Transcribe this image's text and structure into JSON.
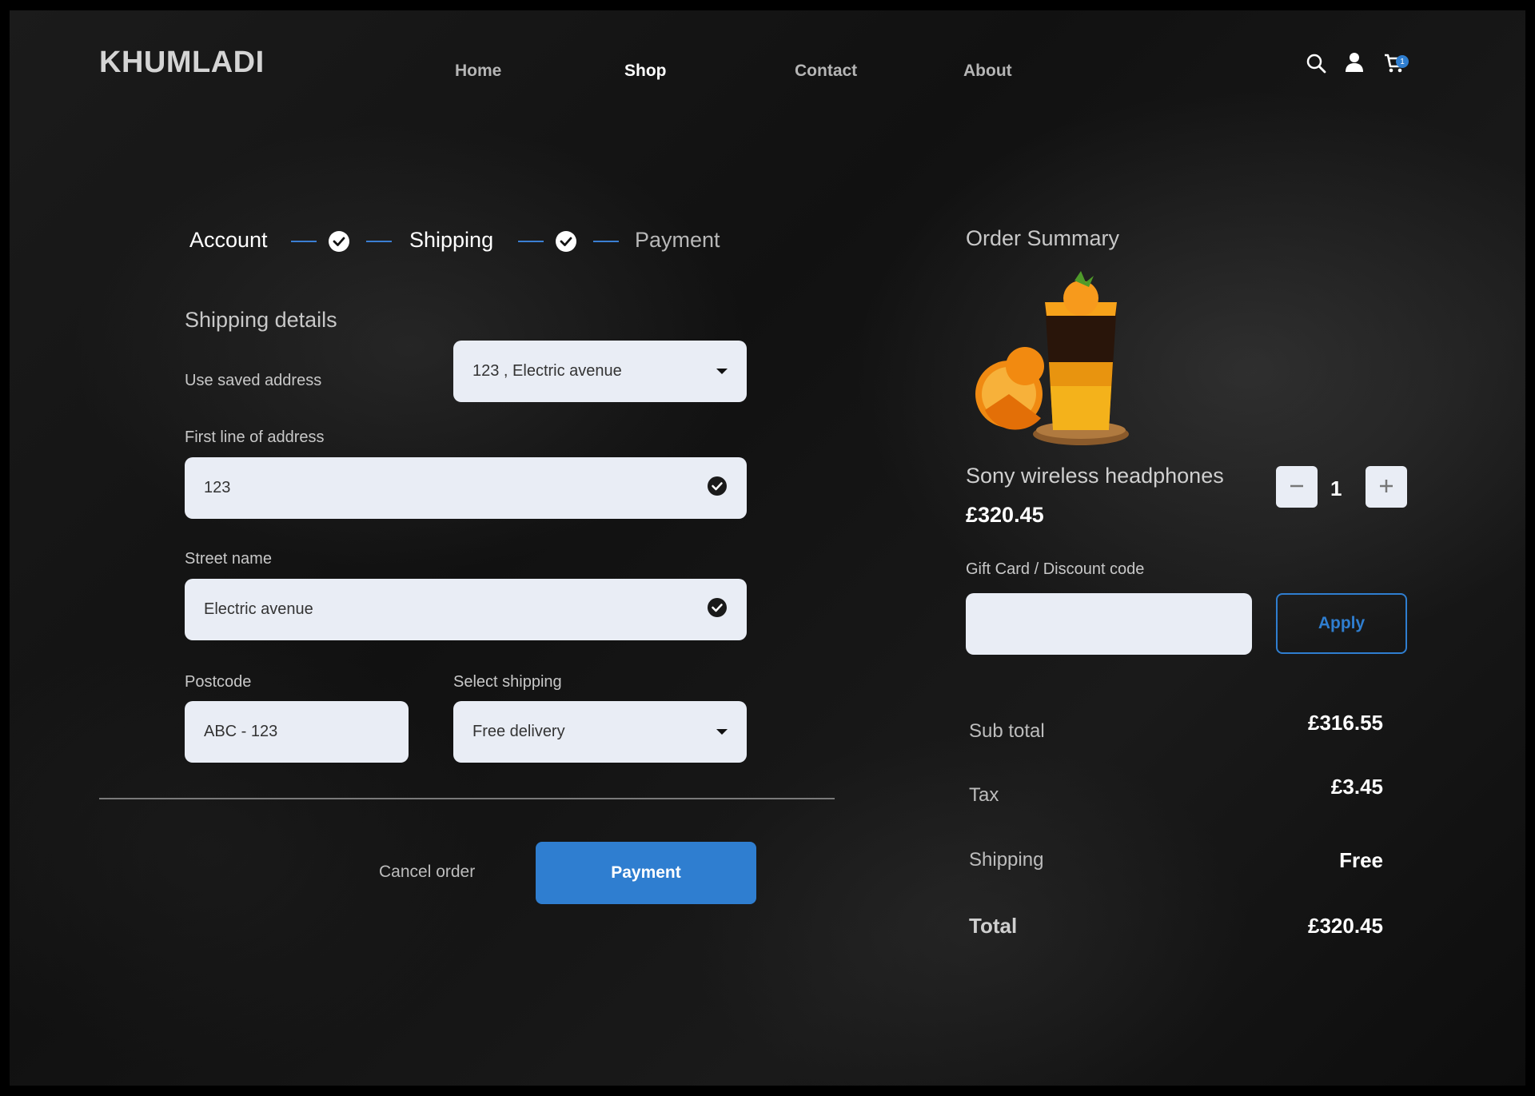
{
  "brand": "KHUMLADI",
  "nav": {
    "home": "Home",
    "shop": "Shop",
    "contact": "Contact",
    "about": "About"
  },
  "cart_count": "1",
  "steps": {
    "account": "Account",
    "shipping": "Shipping",
    "payment": "Payment"
  },
  "form": {
    "title": "Shipping details",
    "saved_address_label": "Use saved address",
    "saved_address_value": "123 , Electric avenue",
    "line1_label": "First line of address",
    "line1_value": "123",
    "street_label": "Street name",
    "street_value": "Electric avenue",
    "postcode_label": "Postcode",
    "postcode_value": "ABC - 123",
    "shipping_label": "Select shipping",
    "shipping_value": "Free delivery",
    "cancel_label": "Cancel order",
    "payment_label": "Payment"
  },
  "summary": {
    "title": "Order Summary",
    "product_name": "Sony wireless headphones",
    "product_price": "£320.45",
    "quantity": "1",
    "discount_label": "Gift Card / Discount code",
    "discount_value": "",
    "apply_label": "Apply",
    "subtotal_label": "Sub total",
    "subtotal_value": "£316.55",
    "tax_label": "Tax",
    "tax_value": "£3.45",
    "shipping_label": "Shipping",
    "shipping_value": "Free",
    "total_label": "Total",
    "total_value": "£320.45"
  },
  "colors": {
    "accent": "#2f7ed0",
    "field_bg": "#e9edf5"
  }
}
